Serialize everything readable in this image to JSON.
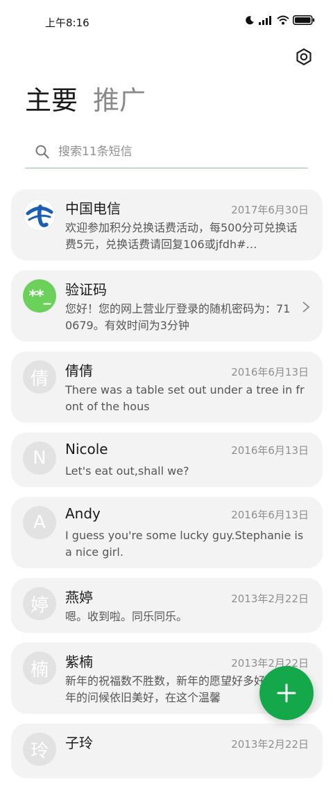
{
  "status_bar": {
    "time": "上午8:16"
  },
  "tabs": [
    {
      "label": "主要"
    },
    {
      "label": "推广"
    }
  ],
  "search": {
    "placeholder": "搜索11条短信"
  },
  "conversations": [
    {
      "name": "中国电信",
      "date": "2017年6月30日",
      "preview": "欢迎参加积分兑换话费活动，每500分可兑换话费5元，兑换话费请回复106或jfdh#…",
      "avatar": "telecom-logo"
    },
    {
      "name": "验证码",
      "date": "",
      "preview": "您好！您的网上营业厅登录的随机密码为：710679。有效时间为3分钟",
      "avatar_text": "**_"
    },
    {
      "name": "倩倩",
      "date": "2016年6月13日",
      "preview": "There was a table set out under a tree in front of the hous",
      "avatar_text": "倩"
    },
    {
      "name": "Nicole",
      "date": "2016年6月13日",
      "preview": "Let's eat out,shall we?",
      "avatar_text": "N"
    },
    {
      "name": "Andy",
      "date": "2016年6月13日",
      "preview": "I guess you're some lucky guy.Stephanie is a nice girl.",
      "avatar_text": "A"
    },
    {
      "name": "燕婷",
      "date": "2013年2月22日",
      "preview": "嗯。收到啦。同乐同乐。",
      "avatar_text": "婷"
    },
    {
      "name": "紫楠",
      "date": "2013年2月22日",
      "preview": "新年的祝福数不胜数，新年的愿望好多好多，新年的问候依旧美好，在这个温馨",
      "avatar_text": "楠"
    },
    {
      "name": "子玲",
      "date": "2013年2月22日",
      "preview": "",
      "avatar_text": "玲"
    }
  ],
  "colors": {
    "accent": "#14a84b",
    "search_underline": "#7fcf8a",
    "verify_avatar": "#6bd15b",
    "telecom_blue": "#1a5fb4"
  },
  "icons": {
    "settings": "gear-icon",
    "search": "search-icon",
    "fab": "plus-icon",
    "chevron": "chevron-right-icon"
  }
}
